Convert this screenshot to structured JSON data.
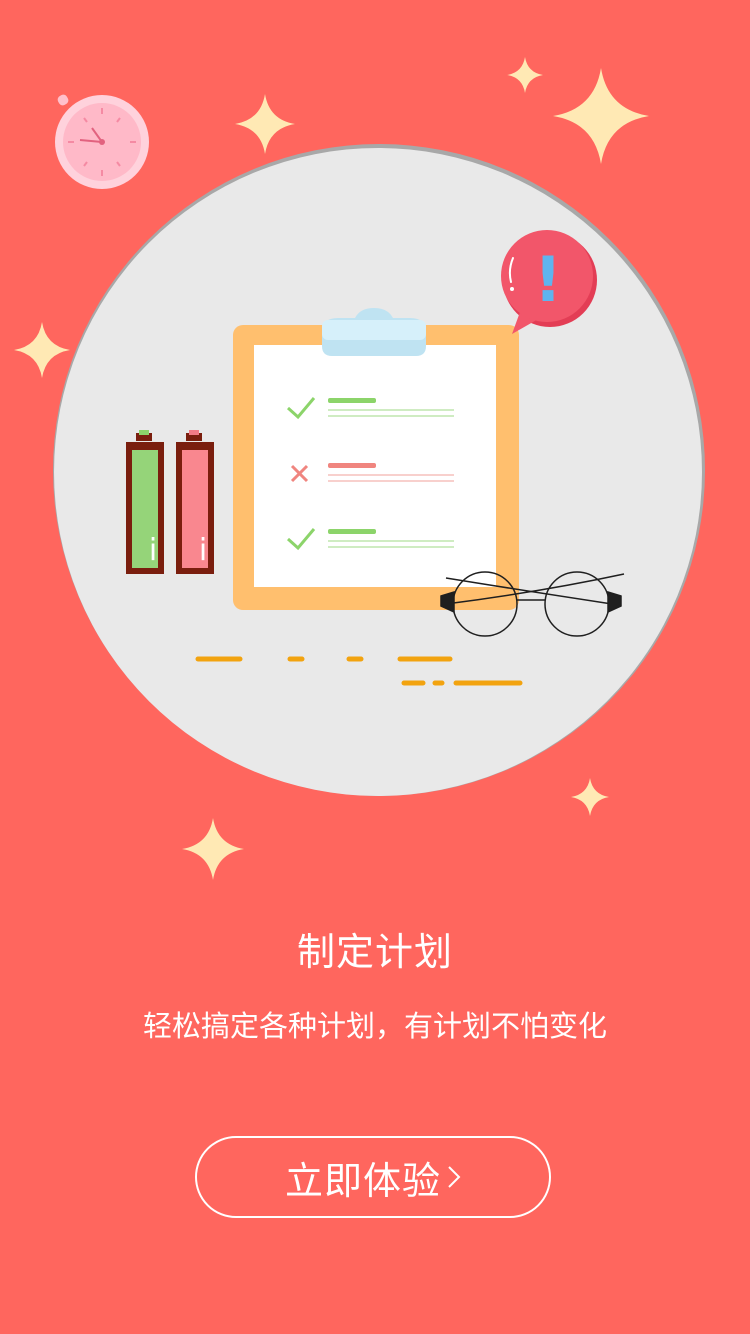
{
  "onboarding": {
    "title": "制定计划",
    "subtitle": "轻松搞定各种计划，有计划不怕变化",
    "cta_label": "立即体验"
  },
  "illustration": {
    "alert_symbol": "!",
    "battery_marker": "i",
    "checklist": [
      "done",
      "cancelled",
      "done"
    ]
  },
  "colors": {
    "background": "#FF665E",
    "circle": "#E9E9E9",
    "sparkle": "#FFE9B4",
    "clipboard": "#FFBF6E",
    "check": "#8CD46A",
    "cross": "#F0857F",
    "alert_bubble": "#F2566A",
    "alert_mark": "#5FB4EE",
    "dash": "#F2A30F"
  },
  "icons": [
    "stopwatch-icon",
    "sparkle-icon",
    "clipboard-icon",
    "check-icon",
    "cross-icon",
    "alert-bubble-icon",
    "battery-icon",
    "glasses-icon",
    "chevron-right-icon"
  ]
}
